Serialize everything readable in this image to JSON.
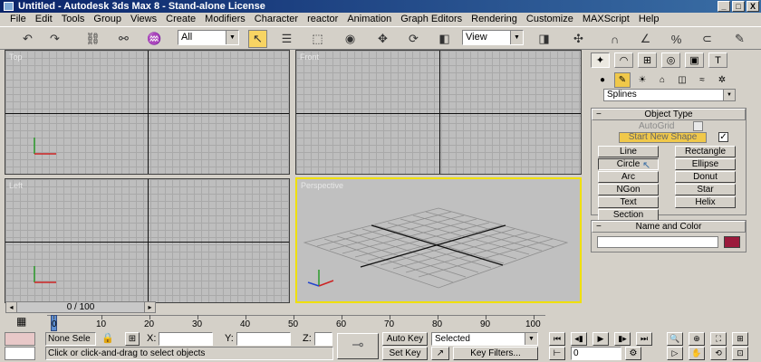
{
  "window": {
    "title": "Untitled - Autodesk 3ds Max 8 - Stand-alone License",
    "min": "_",
    "max": "□",
    "close": "X"
  },
  "menu": [
    "File",
    "Edit",
    "Tools",
    "Group",
    "Views",
    "Create",
    "Modifiers",
    "Character",
    "reactor",
    "Animation",
    "Graph Editors",
    "Rendering",
    "Customize",
    "MAXScript",
    "Help"
  ],
  "toolbar": {
    "selection_filter": "All",
    "ref_coord": "View"
  },
  "viewports": {
    "top": "Top",
    "front": "Front",
    "left": "Left",
    "perspective": "Perspective"
  },
  "command_panel": {
    "category": "Splines",
    "object_type": {
      "title": "Object Type",
      "autogrid": "AutoGrid",
      "start_new_shape": "Start New Shape",
      "buttons": [
        "Line",
        "Rectangle",
        "Circle",
        "Ellipse",
        "Arc",
        "Donut",
        "NGon",
        "Star",
        "Text",
        "Helix",
        "Section"
      ]
    },
    "name_and_color": {
      "title": "Name and Color",
      "name_value": "",
      "color": "#9b1a3c"
    }
  },
  "timeline": {
    "slider": "0 / 100",
    "ticks": [
      "0",
      "10",
      "20",
      "30",
      "40",
      "50",
      "60",
      "70",
      "80",
      "90",
      "100"
    ]
  },
  "status": {
    "selection": "None Sele",
    "x_label": "X:",
    "y_label": "Y:",
    "z_label": "Z:",
    "x_value": "",
    "y_value": "",
    "z_value": "",
    "prompt": "Click or click-and-drag to select objects",
    "auto_key": "Auto Key",
    "set_key": "Set Key",
    "key_mode": "Selected",
    "key_filters": "Key Filters...",
    "frame": "0"
  },
  "colors": {
    "title_start": "#0a246a",
    "active_viewport": "#f0e000",
    "start_new_shape": "#f0c84a"
  }
}
